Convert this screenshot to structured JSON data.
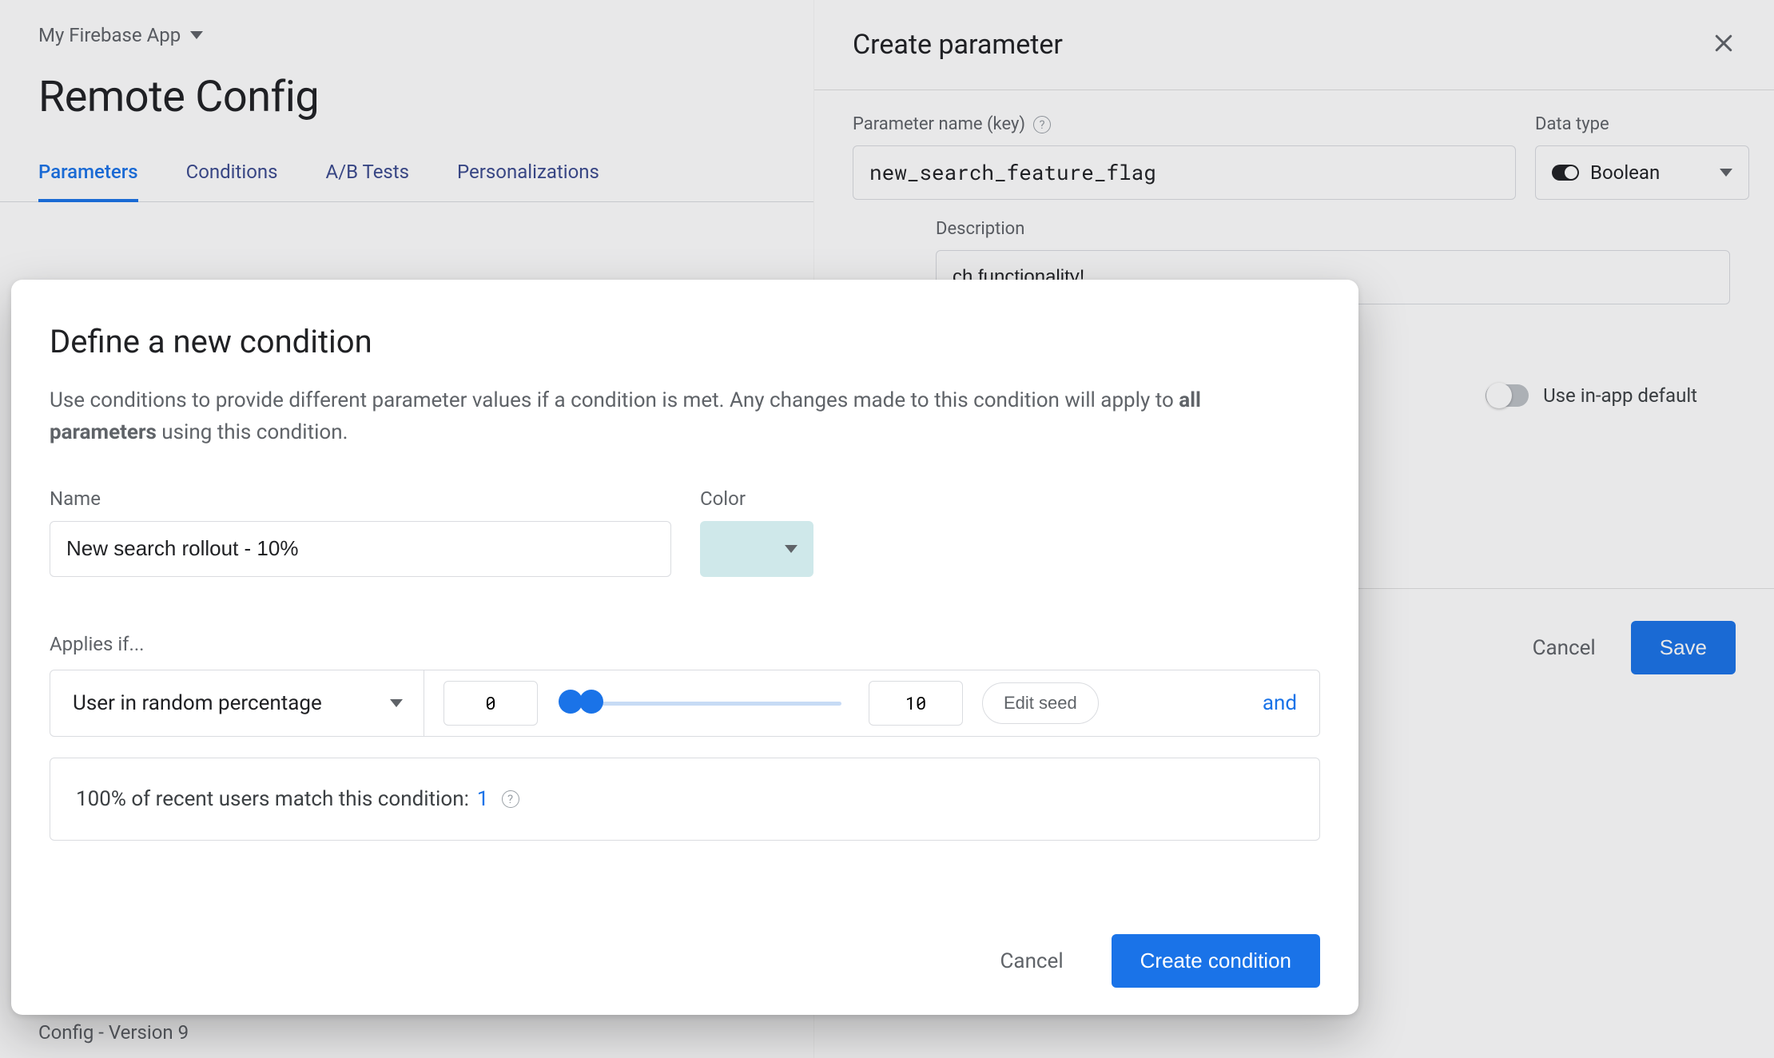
{
  "project": {
    "name": "My Firebase App"
  },
  "page": {
    "title": "Remote Config"
  },
  "tabs": [
    "Parameters",
    "Conditions",
    "A/B Tests",
    "Personalizations"
  ],
  "footer": {
    "version_label": "Config - Version 9"
  },
  "right_panel": {
    "title": "Create parameter",
    "param_label": "Parameter name (key)",
    "param_value": "new_search_feature_flag",
    "datatype_label": "Data type",
    "datatype_value": "Boolean",
    "description_label": "Description",
    "description_value_visible": "ch functionality!",
    "use_default_label": "Use in-app default",
    "cancel": "Cancel",
    "save": "Save"
  },
  "modal": {
    "title": "Define a new condition",
    "desc_prefix": "Use conditions to provide different parameter values if a condition is met. Any changes made to this condition will apply to ",
    "desc_bold": "all parameters",
    "desc_suffix": " using this condition.",
    "name_label": "Name",
    "name_value": "New search rollout - 10%",
    "color_label": "Color",
    "color_hex": "#cfe8ea",
    "applies_label": "Applies if...",
    "rule_type": "User in random percentage",
    "range_low": "0",
    "range_high": "10",
    "edit_seed": "Edit seed",
    "and": "and",
    "match_text": "100% of recent users match this condition: ",
    "match_count": "1",
    "cancel": "Cancel",
    "create": "Create condition"
  }
}
